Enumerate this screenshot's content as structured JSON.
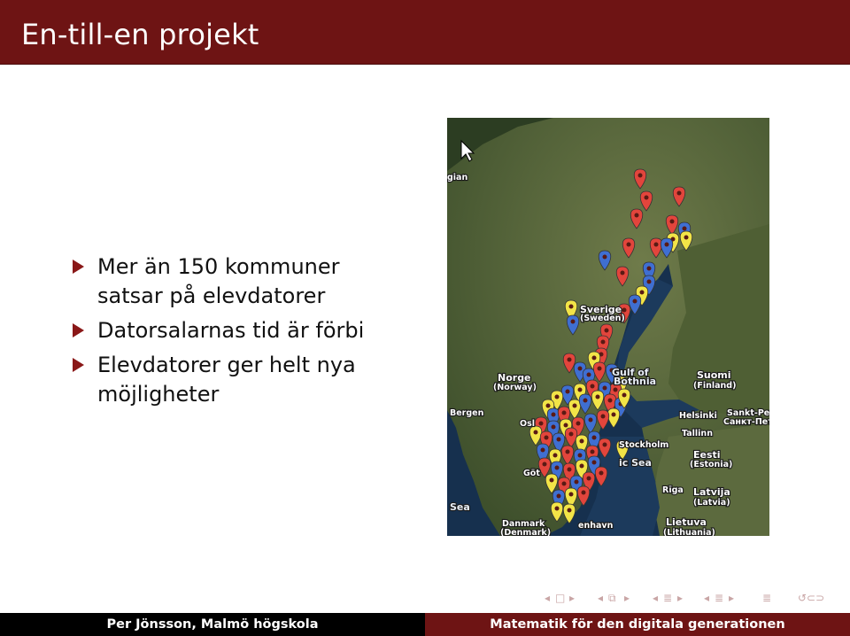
{
  "slide": {
    "title": "En-till-en projekt",
    "bullets": [
      {
        "line1": "Mer än 150 kommuner",
        "line2": "satsar på elevdatorer"
      },
      {
        "line1": "Datorsalarnas tid är förbi",
        "line2": ""
      },
      {
        "line1": "Elevdatorer ger helt nya",
        "line2": "möjligheter"
      }
    ]
  },
  "map": {
    "labels": {
      "sverige": "Sverige",
      "sweden": "(Sweden)",
      "norge": "Norge",
      "norway": "(Norway)",
      "gulf1": "Gulf of",
      "gulf2": "Bothnia",
      "suomi": "Suomi",
      "finland": "(Finland)",
      "bergen": "Bergen",
      "oslo": "Osl",
      "helsinki": "Helsinki",
      "sanktpet": "Sankt-Pet",
      "sanktpet_ru": "Санкт-Пет",
      "tallinn": "Tallinn",
      "stockholm": "Stockholm",
      "eesti": "Eesti",
      "estonia": "(Estonia)",
      "balticsea": "ic Sea",
      "got": "Göt",
      "riga": "Rīga",
      "latvija": "Latvija",
      "latvia": "(Latvia)",
      "sea": "Sea",
      "lietuva": "Lietuva",
      "lithuania": "(Lithuania)",
      "danmark": "Danmark",
      "denmark": "(Denmark)",
      "kobenhavn": "enhavn",
      "gian": "gian"
    },
    "colors": {
      "red": "#e2453c",
      "blue": "#3f6fd1",
      "yellow": "#f2e447"
    }
  },
  "nav": {
    "frame_prev": "◂",
    "frame_icon": "□",
    "frame_next": "▸",
    "sub_prev": "◂",
    "sub_icon": "⧉",
    "sub_next": "▸",
    "sec_prev": "◂",
    "sec_icon": "≣",
    "sec_next": "▸",
    "subsec_prev": "◂",
    "subsec_icon": "≣",
    "subsec_next": "▸",
    "doc_icon": "≣",
    "search_icon": "↺⊂⊃"
  },
  "footer": {
    "left": "Per Jönsson, Malmö högskola",
    "right": "Matematik för den digitala generationen"
  }
}
